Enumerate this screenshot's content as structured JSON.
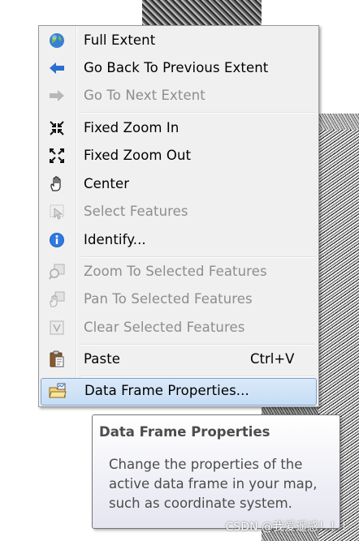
{
  "menu": {
    "items": [
      {
        "label": "Full Extent",
        "icon": "globe-icon",
        "enabled": true
      },
      {
        "label": "Go Back To Previous Extent",
        "icon": "arrow-left-icon",
        "enabled": true
      },
      {
        "label": "Go To Next Extent",
        "icon": "arrow-right-icon",
        "enabled": false
      },
      {
        "label": "Fixed Zoom In",
        "icon": "fixed-zoom-in-icon",
        "enabled": true
      },
      {
        "label": "Fixed Zoom Out",
        "icon": "fixed-zoom-out-icon",
        "enabled": true
      },
      {
        "label": "Center",
        "icon": "hand-icon",
        "enabled": true
      },
      {
        "label": "Select Features",
        "icon": "select-features-icon",
        "enabled": false
      },
      {
        "label": "Identify...",
        "icon": "info-icon",
        "enabled": true
      },
      {
        "label": "Zoom To Selected Features",
        "icon": "zoom-selected-icon",
        "enabled": false
      },
      {
        "label": "Pan To Selected Features",
        "icon": "pan-selected-icon",
        "enabled": false
      },
      {
        "label": "Clear Selected Features",
        "icon": "clear-selection-icon",
        "enabled": false
      },
      {
        "label": "Paste",
        "shortcut": "Ctrl+V",
        "icon": "clipboard-icon",
        "enabled": true
      },
      {
        "label": "Data Frame Properties...",
        "icon": "data-frame-properties-icon",
        "enabled": true,
        "selected": true
      }
    ]
  },
  "tooltip": {
    "title": "Data Frame Properties",
    "body": "Change the properties of the active data frame in your map, such as coordinate system."
  },
  "watermark": "CSDN @我爱遥感！！！",
  "colors": {
    "menu_bg": "#f0f0f0",
    "highlight": "#c6ddf5",
    "disabled_text": "#8d8d8d",
    "tooltip_text": "#4c4c4c"
  }
}
